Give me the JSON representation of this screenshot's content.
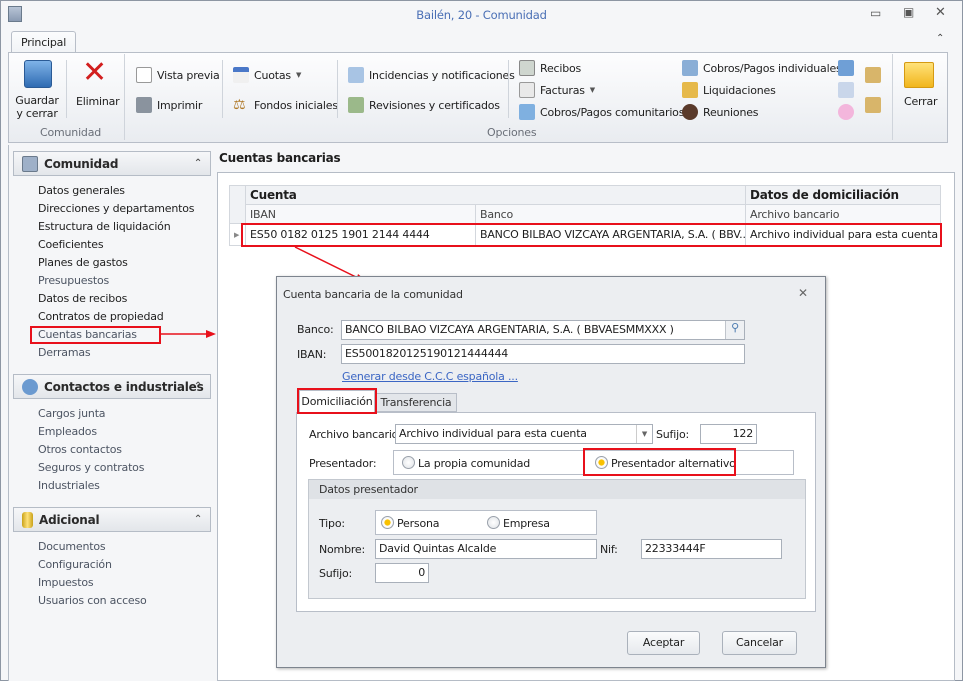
{
  "window": {
    "title": "Bailén, 20 - Comunidad",
    "controls": [
      "minimize",
      "restore",
      "close"
    ]
  },
  "ribbon": {
    "tab": "Principal",
    "groups": [
      {
        "label": "Comunidad"
      },
      {
        "label": "Opciones"
      }
    ],
    "guardar": "Guardar\ny cerrar",
    "eliminar": "Eliminar",
    "vista_previa": "Vista previa",
    "imprimir": "Imprimir",
    "cuotas": "Cuotas",
    "fondos": "Fondos iniciales",
    "incidencias": "Incidencias y notificaciones",
    "revisiones": "Revisiones y certificados",
    "recibos": "Recibos",
    "facturas": "Facturas",
    "cobros_com": "Cobros/Pagos comunitarios",
    "cobros_ind": "Cobros/Pagos individuales",
    "liquidaciones": "Liquidaciones",
    "reuniones": "Reuniones",
    "cerrar": "Cerrar"
  },
  "sidebar": {
    "sections": [
      {
        "title": "Comunidad",
        "items": [
          "Datos generales",
          "Direcciones y departamentos",
          "Estructura de liquidación",
          "Coeficientes",
          "Planes de gastos",
          "Presupuestos",
          "Datos de recibos",
          "Contratos de propiedad",
          "Cuentas bancarias",
          "Derramas"
        ]
      },
      {
        "title": "Contactos e industriales",
        "items": [
          "Cargos junta",
          "Empleados",
          "Otros contactos",
          "Seguros y contratos",
          "Industriales"
        ]
      },
      {
        "title": "Adicional",
        "items": [
          "Documentos",
          "Configuración",
          "Impuestos",
          "Usuarios con acceso"
        ]
      }
    ]
  },
  "main": {
    "title": "Cuentas bancarias",
    "grid": {
      "band1": "Cuenta",
      "band2": "Datos de domiciliación",
      "columns": [
        "IBAN",
        "Banco",
        "Archivo bancario"
      ],
      "rows": [
        [
          "ES50 0182 0125 1901 2144 4444",
          "BANCO BILBAO VIZCAYA ARGENTARIA, S.A. ( BBV...",
          "Archivo individual para esta cuenta"
        ]
      ]
    }
  },
  "dialog": {
    "title": "Cuenta bancaria de la comunidad",
    "banco_label": "Banco:",
    "banco": "BANCO BILBAO VIZCAYA ARGENTARIA, S.A. ( BBVAESMMXXX )",
    "iban_label": "IBAN:",
    "iban": "ES5001820125190121444444",
    "link": "Generar desde C.C.C española ...",
    "tabs": [
      "Domiciliación",
      "Transferencia"
    ],
    "archivo_label": "Archivo bancario:",
    "archivo": "Archivo individual para esta cuenta",
    "sufijo_label": "Sufijo:",
    "sufijo": "122",
    "presentador_label": "Presentador:",
    "presentador_options": [
      "La propia comunidad",
      "Presentador alternativo"
    ],
    "presentador_selected": 1,
    "group_title": "Datos presentador",
    "tipo_label": "Tipo:",
    "tipo_options": [
      "Persona",
      "Empresa"
    ],
    "tipo_selected": 0,
    "nombre_label": "Nombre:",
    "nombre": "David Quintas Alcalde",
    "nif_label": "Nif:",
    "nif": "22333444F",
    "sufijo2_label": "Sufijo:",
    "sufijo2": "0",
    "aceptar": "Aceptar",
    "cancelar": "Cancelar"
  },
  "colors": {
    "highlight": "#e8101b",
    "title": "#4a6fb5",
    "radio_on": "#f9c100"
  }
}
